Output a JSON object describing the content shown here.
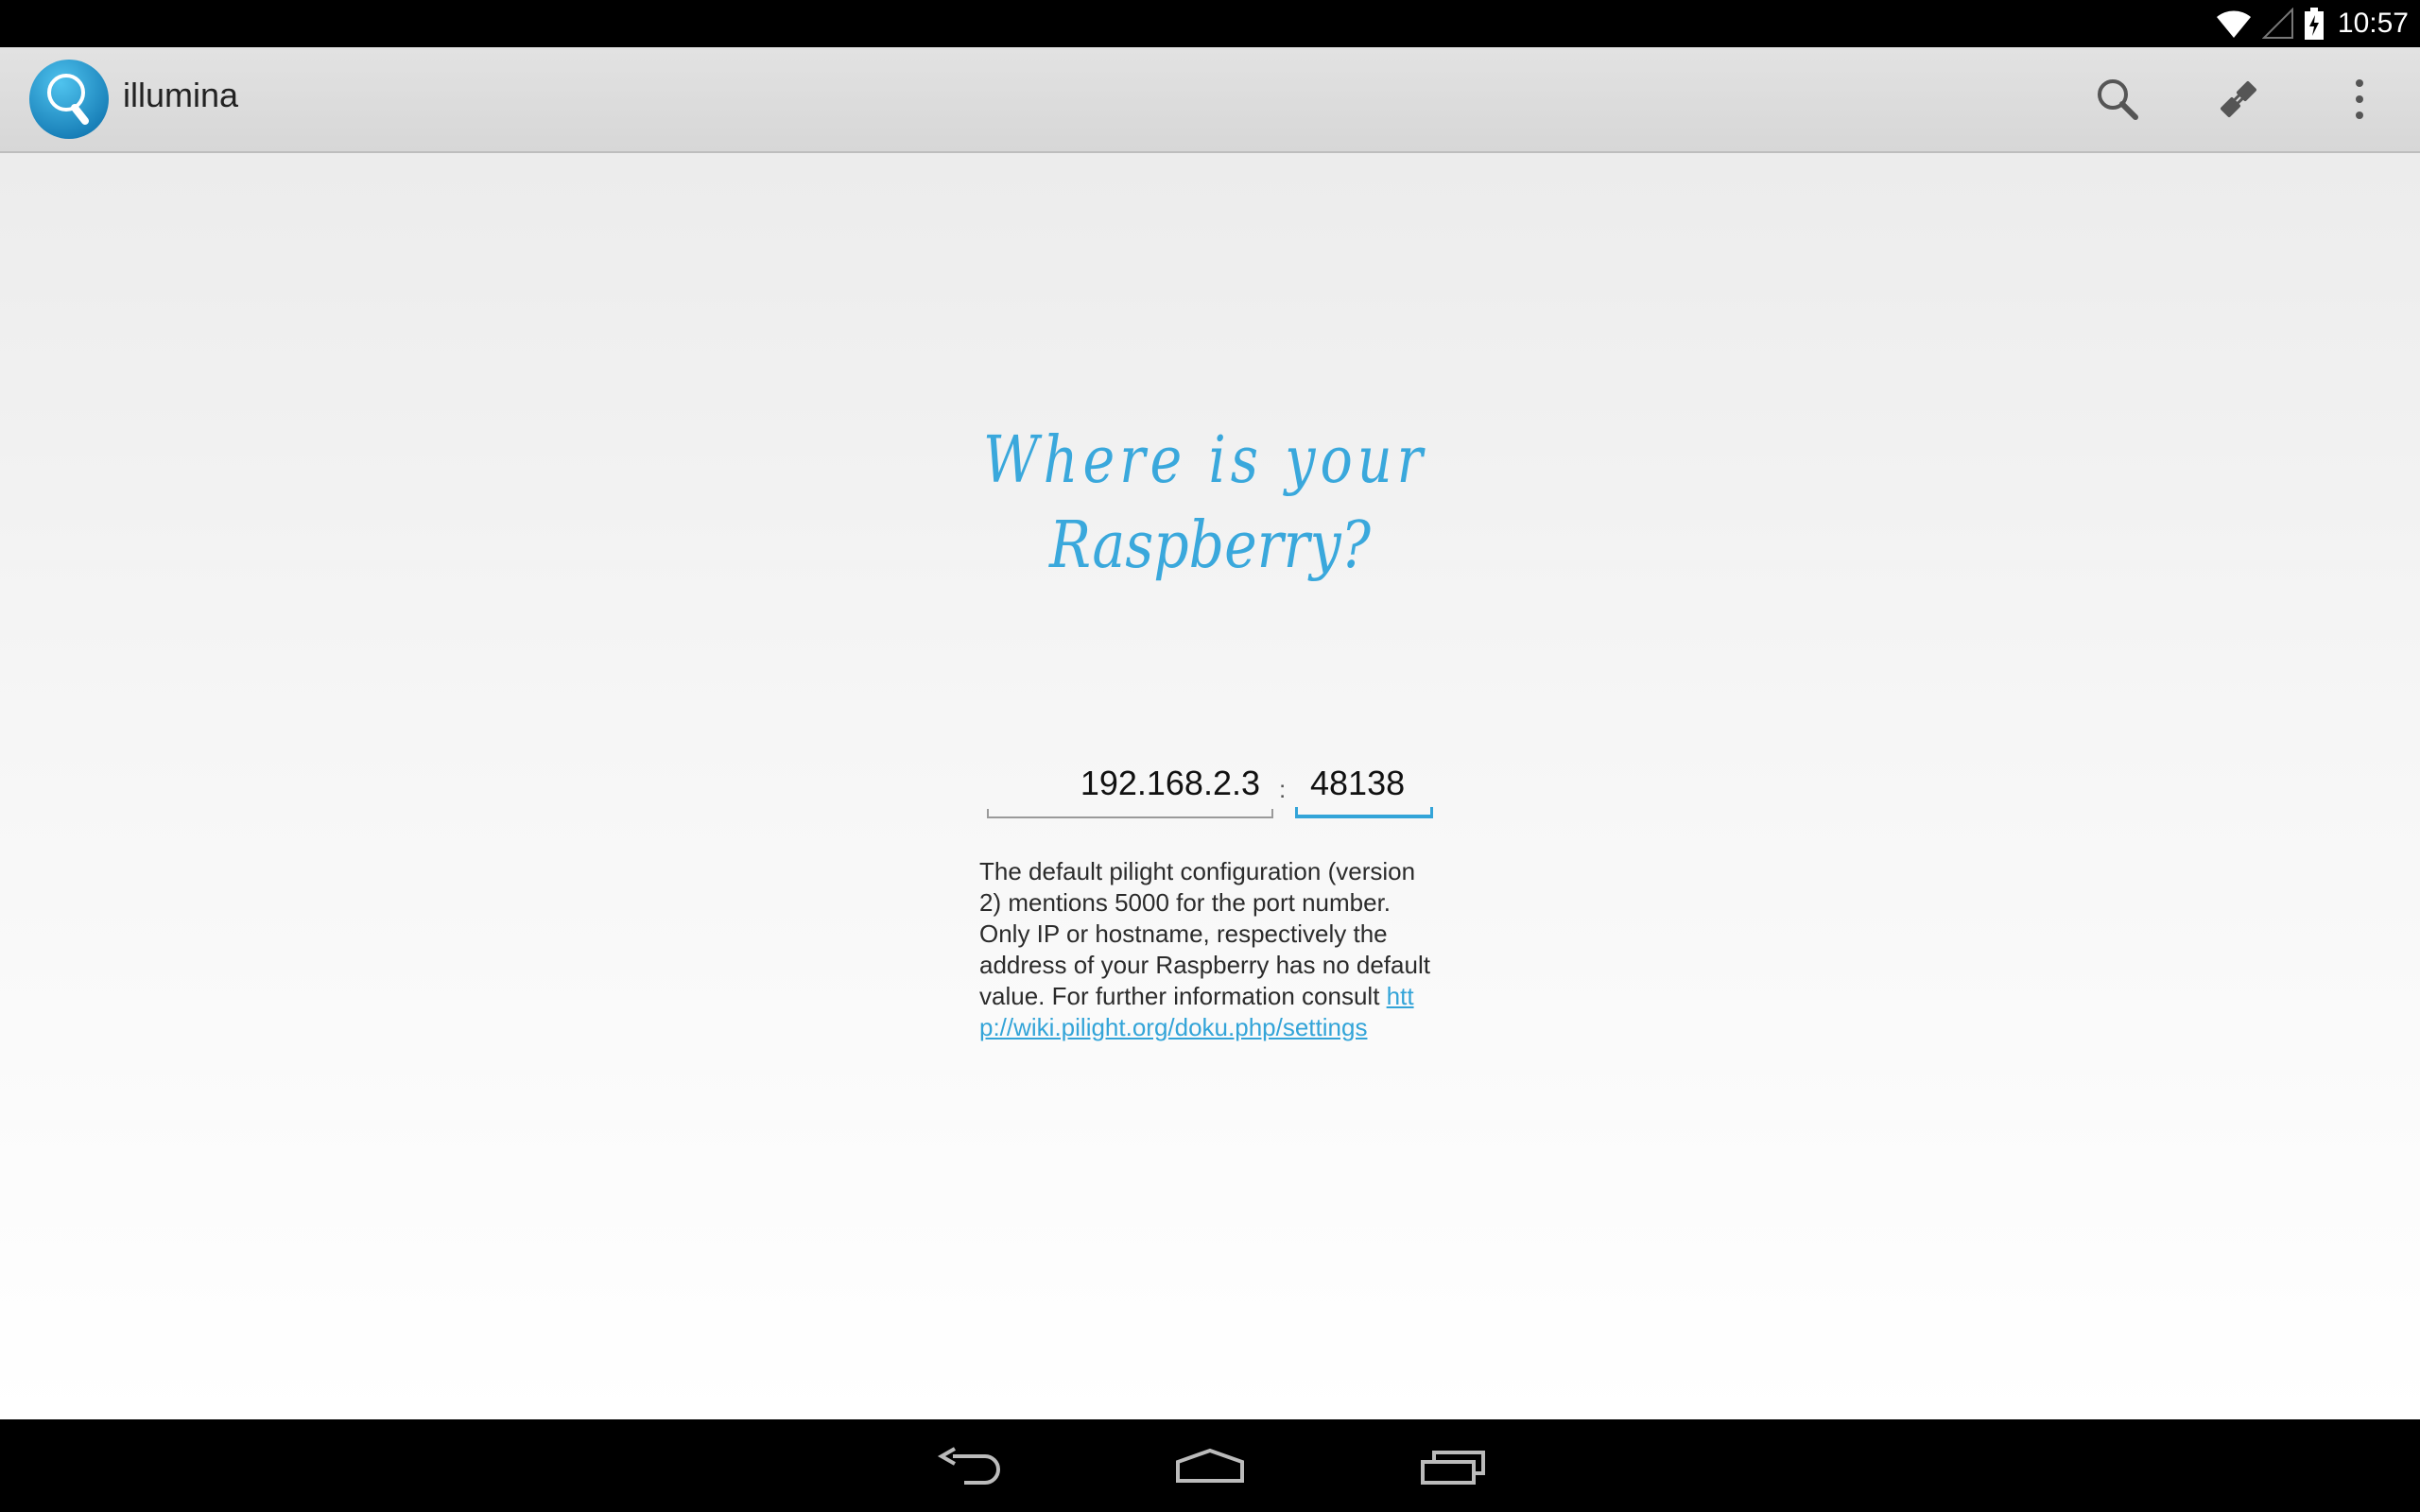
{
  "status_bar": {
    "time": "10:57",
    "icons": [
      "wifi-icon",
      "signal-icon",
      "battery-charging-icon"
    ]
  },
  "action_bar": {
    "title": "illumina",
    "logo_icon": "lightbulb-icon",
    "actions": [
      {
        "name": "search",
        "icon": "search-icon"
      },
      {
        "name": "connect",
        "icon": "plug-icon"
      },
      {
        "name": "overflow",
        "icon": "more-vert-icon"
      }
    ]
  },
  "main": {
    "heading_line1": "Where is your",
    "heading_line2": "Raspberry?",
    "host_value": "192.168.2.3",
    "separator": ":",
    "port_value": "48138",
    "description_text": "The default pilight configuration (version 2) mentions 5000 for the port number. Only IP or hostname, respectively the address of your Raspberry has no default value. For further information consult ",
    "link_text": "http://wiki.pilight.org/doku.php/settings"
  },
  "nav_bar": {
    "buttons": [
      "back-icon",
      "home-icon",
      "recents-icon"
    ]
  },
  "colors": {
    "accent": "#33a4d8",
    "status_bar": "#000000",
    "action_bar": "#dcdcdc",
    "handwriting": "#3aa8dc"
  }
}
